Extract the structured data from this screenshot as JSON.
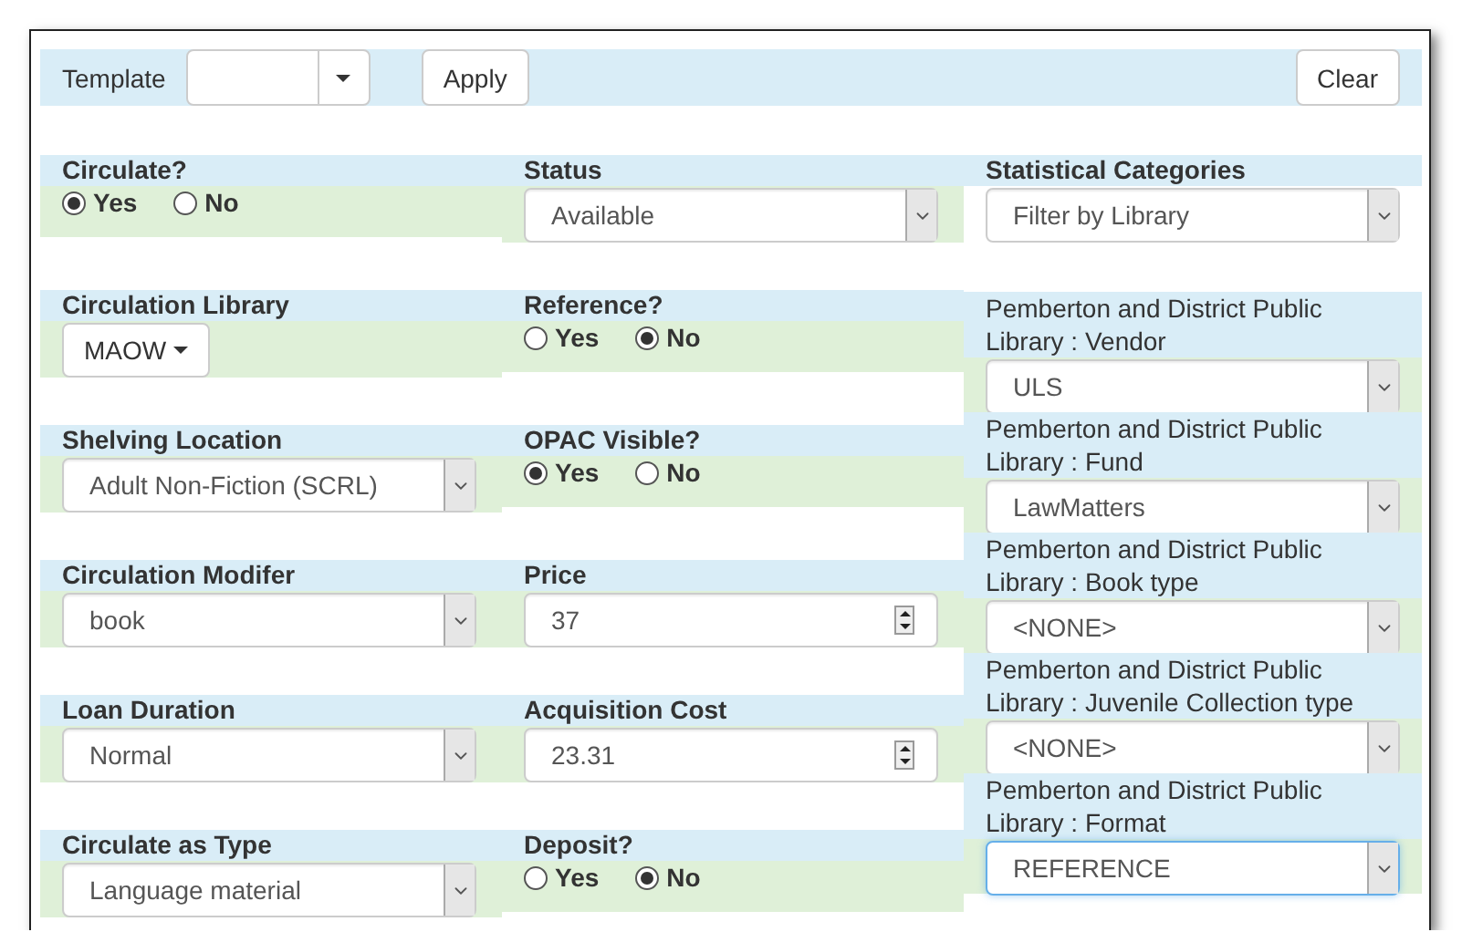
{
  "toolbar": {
    "template_label": "Template",
    "apply": "Apply",
    "clear": "Clear"
  },
  "rows": [
    [
      {
        "label": "Circulate?",
        "kind": "radio",
        "options": [
          {
            "label": "Yes",
            "selected": true
          },
          {
            "label": "No",
            "selected": false
          }
        ]
      },
      {
        "label": "Status",
        "kind": "select",
        "value": "Available"
      }
    ],
    [
      {
        "label": "Circulation Library",
        "kind": "menu_button",
        "value": "MAOW"
      },
      {
        "label": "Reference?",
        "kind": "radio",
        "options": [
          {
            "label": "Yes",
            "selected": false
          },
          {
            "label": "No",
            "selected": true
          }
        ]
      }
    ],
    [
      {
        "label": "Shelving Location",
        "kind": "select",
        "value": "Adult Non-Fiction (SCRL)"
      },
      {
        "label": "OPAC Visible?",
        "kind": "radio",
        "options": [
          {
            "label": "Yes",
            "selected": true
          },
          {
            "label": "No",
            "selected": false
          }
        ]
      }
    ],
    [
      {
        "label": "Circulation Modifer",
        "kind": "select",
        "value": "book"
      },
      {
        "label": "Price",
        "kind": "number",
        "value": "37"
      }
    ],
    [
      {
        "label": "Loan Duration",
        "kind": "select",
        "value": "Normal"
      },
      {
        "label": "Acquisition Cost",
        "kind": "number",
        "value": "23.31"
      }
    ],
    [
      {
        "label": "Circulate as Type",
        "kind": "select",
        "value": "Language material"
      },
      {
        "label": "Deposit?",
        "kind": "radio",
        "options": [
          {
            "label": "Yes",
            "selected": false
          },
          {
            "label": "No",
            "selected": true
          }
        ]
      }
    ]
  ],
  "stat_categories": {
    "label": "Statistical Categories",
    "filter": "Filter by Library",
    "items": [
      {
        "label": "Pemberton and District Public Library : Vendor",
        "value": "ULS",
        "focused": false
      },
      {
        "label": "Pemberton and District Public Library : Fund",
        "value": "LawMatters",
        "focused": false
      },
      {
        "label": "Pemberton and District Public Library : Book type",
        "value": "<NONE>",
        "focused": false
      },
      {
        "label": "Pemberton and District Public Library : Juvenile Collection type",
        "value": "<NONE>",
        "focused": false
      },
      {
        "label": "Pemberton and District Public Library : Format",
        "value": "REFERENCE",
        "focused": true
      }
    ]
  }
}
